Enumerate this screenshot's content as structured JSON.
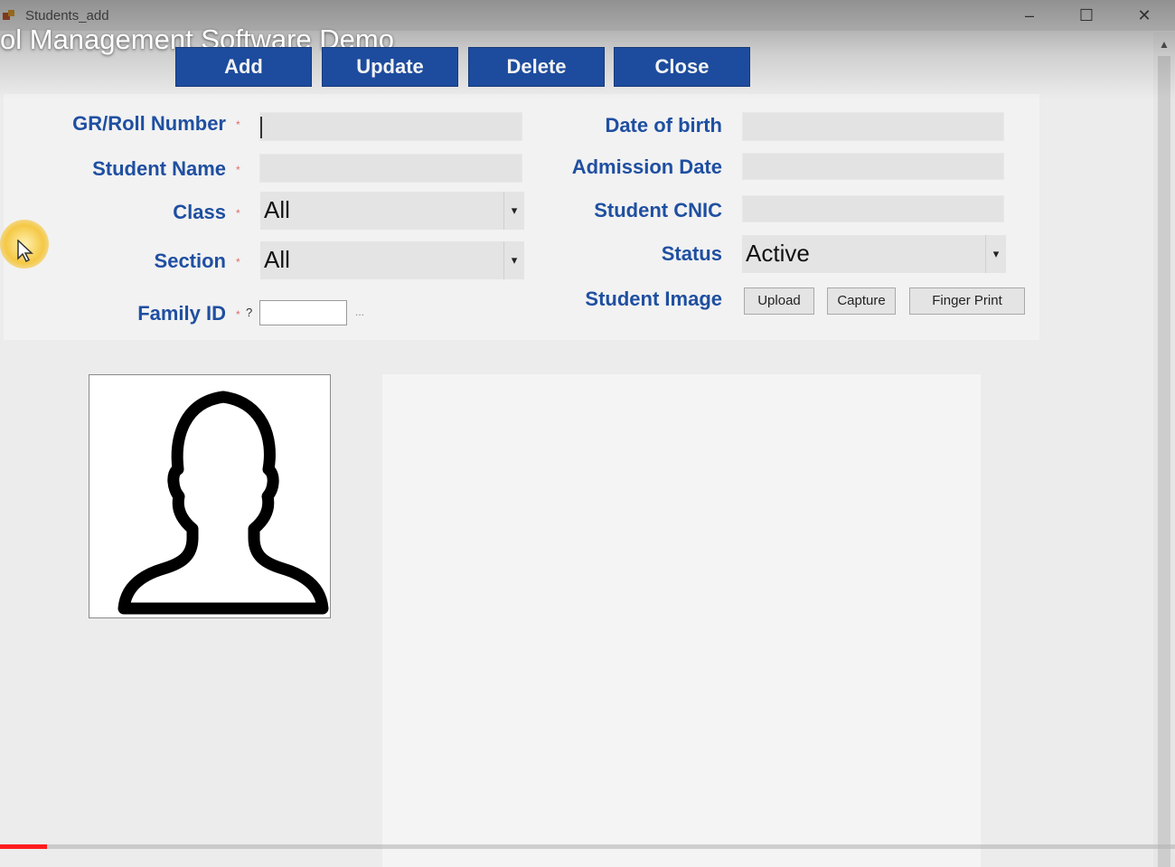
{
  "window": {
    "title": "Students_add",
    "minimize_glyph": "–",
    "maximize_glyph": "☐",
    "close_glyph": "✕"
  },
  "video": {
    "title": "ol Management Software Demo",
    "progress_fraction": 0.04,
    "progress_color": "#ff1d1d"
  },
  "toolbar": {
    "add": "Add",
    "update": "Update",
    "delete": "Delete",
    "close": "Close"
  },
  "form": {
    "gr_roll_label": "GR/Roll Number",
    "student_name_label": "Student Name",
    "class_label": "Class",
    "class_value": "All",
    "section_label": "Section",
    "section_value": "All",
    "family_id_label": "Family ID",
    "family_id_hint": "?",
    "family_browse": "...",
    "required_mark": "*",
    "dob_label": "Date of birth",
    "admission_label": "Admission Date",
    "cnic_label": "Student CNIC",
    "status_label": "Status",
    "status_value": "Active",
    "image_label": "Student Image",
    "upload": "Upload",
    "capture": "Capture",
    "fingerprint": "Finger Print",
    "dropdown_glyph": "▾"
  },
  "colors": {
    "button_blue": "#1d4c9e",
    "label_blue": "#1f4fa1",
    "required_red": "#e26a6a"
  },
  "icons": {
    "photo_placeholder": "person-silhouette-icon",
    "cursor": "mouse-pointer-icon"
  }
}
